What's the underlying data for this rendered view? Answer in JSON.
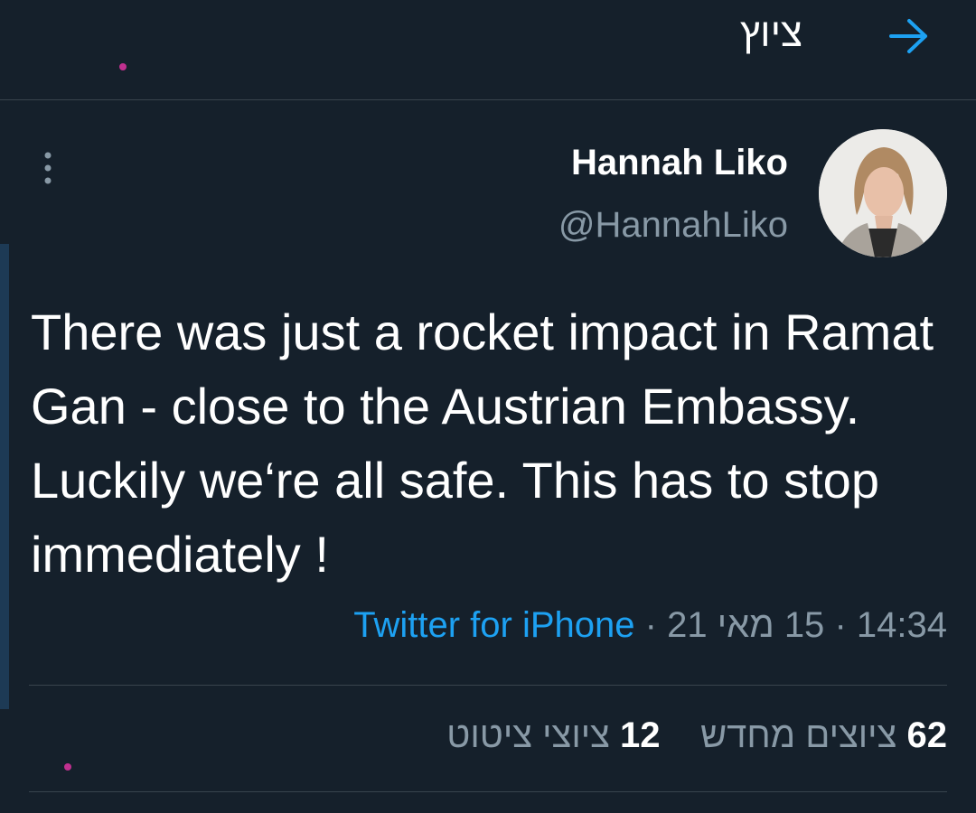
{
  "header": {
    "title": "ציוץ",
    "back_icon": "arrow-right-icon",
    "accent": "#1da1f2"
  },
  "tweet": {
    "author_name": "Hannah Liko",
    "author_handle": "@HannahLiko",
    "text": "There was just a rocket impact in Ramat Gan - close to the Austrian Embassy. Luckily we‘re all safe. This has to stop immediately !",
    "time": "14:34",
    "date": "15 מאי 21",
    "separator": "·",
    "source": "Twitter for iPhone",
    "more_icon": "more-vertical-icon"
  },
  "stats": {
    "retweets_count": "62",
    "retweets_label": "ציוצים מחדש",
    "quotes_count": "12",
    "quotes_label": "ציוצי ציטוט"
  },
  "colors": {
    "background": "#15202b",
    "divider": "#38444d",
    "secondary_text": "#8899a6",
    "link": "#1da1f2"
  }
}
